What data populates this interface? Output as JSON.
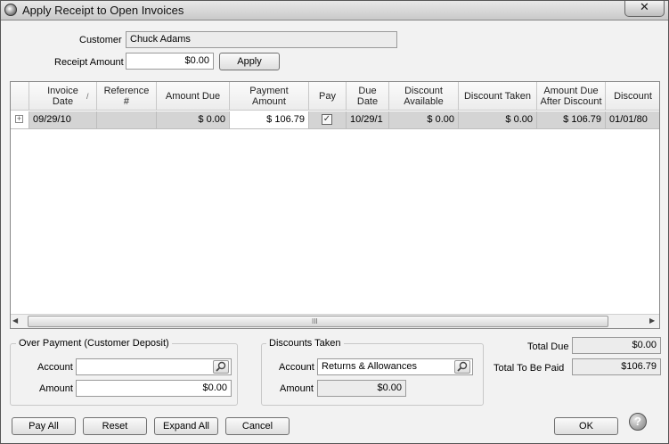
{
  "window": {
    "title": "Apply Receipt to Open Invoices",
    "close_label": "✕"
  },
  "customer": {
    "label": "Customer",
    "value": "Chuck Adams"
  },
  "receipt": {
    "label": "Receipt Amount",
    "value": "$0.00",
    "apply_label": "Apply"
  },
  "grid": {
    "columns": [
      "Invoice\nDate",
      "Reference\n#",
      "Amount Due",
      "Payment\nAmount",
      "Pay",
      "Due\nDate",
      "Discount\nAvailable",
      "Discount Taken",
      "Amount Due\nAfter Discount",
      "Discount"
    ],
    "rows": [
      {
        "expand": "+",
        "invoice_date": "09/29/10",
        "reference": "",
        "amount_due": "$ 0.00",
        "payment_amount": "$ 106.79",
        "pay": true,
        "due_date": "10/29/1",
        "discount_available": "$ 0.00",
        "discount_taken": "$ 0.00",
        "amount_due_after_discount": "$ 106.79",
        "discount": "01/01/80"
      }
    ],
    "scroll_grip": "III"
  },
  "over_payment": {
    "title": "Over Payment (Customer Deposit)",
    "account_label": "Account",
    "account_value": "",
    "amount_label": "Amount",
    "amount_value": "$0.00"
  },
  "discounts_taken": {
    "title": "Discounts Taken",
    "account_label": "Account",
    "account_value": "Returns & Allowances",
    "amount_label": "Amount",
    "amount_value": "$0.00"
  },
  "totals": {
    "total_due_label": "Total Due",
    "total_due_value": "$0.00",
    "to_be_paid_label": "Total To Be Paid",
    "to_be_paid_value": "$106.79"
  },
  "buttons": {
    "pay_all": "Pay All",
    "reset": "Reset",
    "expand_all": "Expand All",
    "cancel": "Cancel",
    "ok": "OK",
    "help": "?"
  }
}
